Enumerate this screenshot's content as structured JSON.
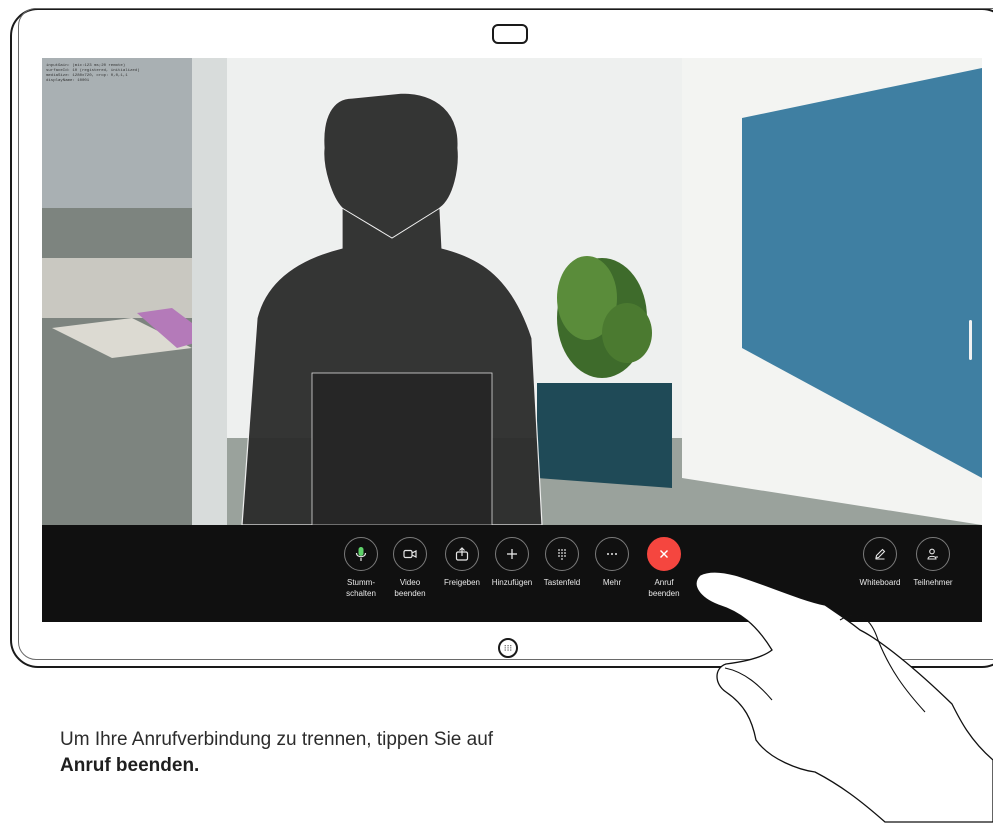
{
  "call": {
    "debug_overlay": "inputGain: (mic:123 ms;20 remote)\nsurfaceId: 10 (registered, initialized)\nmediaSize: 1280x720, crop: 0,0,1,1\ndisplayName: 10001"
  },
  "toolbar": {
    "buttons": [
      {
        "id": "mute",
        "label": "Stumm-\nschalten",
        "icon": "microphone-icon"
      },
      {
        "id": "video",
        "label": "Video\nbeenden",
        "icon": "video-camera-icon"
      },
      {
        "id": "share",
        "label": "Freigeben",
        "icon": "share-icon"
      },
      {
        "id": "add",
        "label": "Hinzufügen",
        "icon": "plus-icon"
      },
      {
        "id": "keypad",
        "label": "Tastenfeld",
        "icon": "keypad-icon"
      },
      {
        "id": "more",
        "label": "Mehr",
        "icon": "more-icon"
      },
      {
        "id": "end",
        "label": "Anruf\nbeenden",
        "icon": "close-icon"
      },
      {
        "id": "whiteboard",
        "label": "Whiteboard",
        "icon": "pencil-icon"
      },
      {
        "id": "participants",
        "label": "Teilnehmer",
        "icon": "person-icon"
      }
    ]
  },
  "caption": {
    "text": "Um Ihre Anrufverbindung zu trennen, tippen Sie auf",
    "emphasis": "Anruf beenden."
  },
  "colors": {
    "end_call": "#f5463f",
    "toolbar_bg": "#101010",
    "mute_icon": "#5fd36a"
  }
}
